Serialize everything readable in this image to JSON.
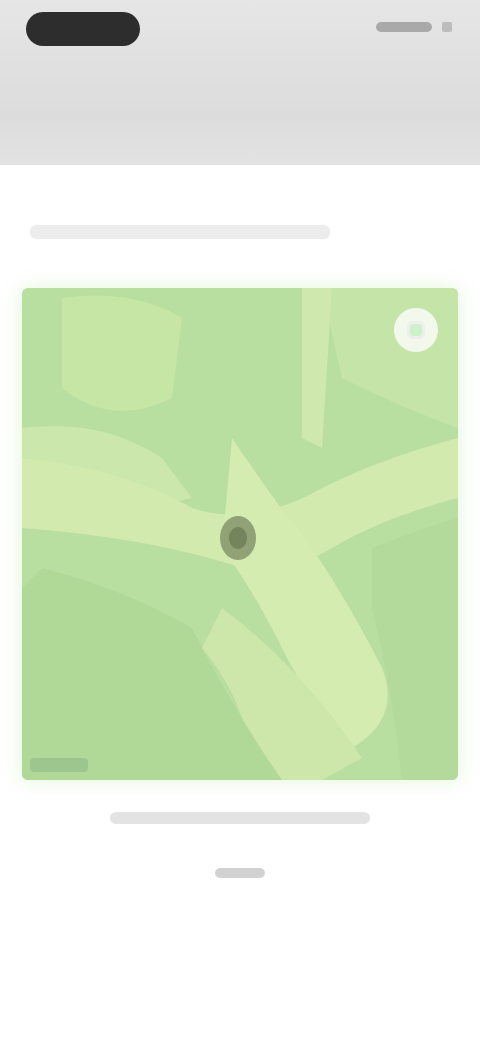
{
  "colors": {
    "header_bg": "#dcdcdc",
    "map_land": "#b5dc9c",
    "map_road": "#d6ebb0",
    "map_marker": "#7f8f66",
    "logo": "#2d2d2d"
  },
  "icons": {
    "recenter": "recenter-icon",
    "marker": "location-pin-icon"
  },
  "header": {
    "logo_text": "",
    "action_label": ""
  },
  "content": {
    "section_title": "",
    "caption": "",
    "done_label": ""
  }
}
